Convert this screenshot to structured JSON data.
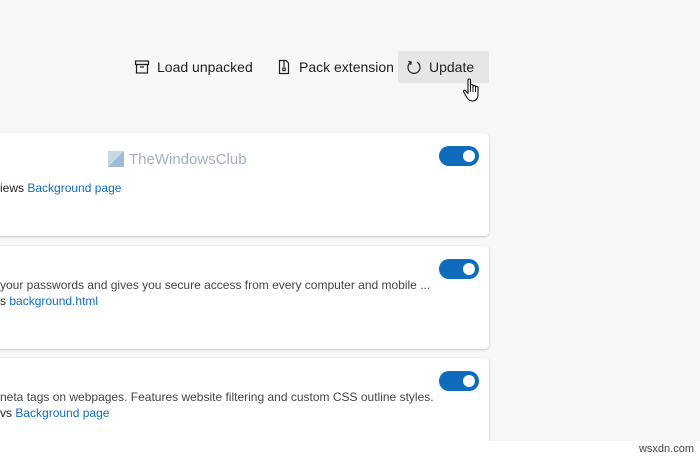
{
  "toolbar": {
    "load_unpacked_label": "Load unpacked",
    "pack_extension_label": "Pack extension",
    "update_label": "Update"
  },
  "extensions": [
    {
      "description": "",
      "views_prefix": "iews",
      "views_link": "Background page",
      "enabled": true
    },
    {
      "description": "your passwords and gives you secure access from every computer and mobile ...",
      "views_prefix": "s",
      "views_link": "background.html",
      "enabled": true
    },
    {
      "description": "neta tags on webpages. Features website filtering and custom CSS outline styles.",
      "views_prefix": "vs",
      "views_link": "Background page",
      "enabled": true
    }
  ],
  "watermark": {
    "text": "TheWindowsClub"
  },
  "site_mark": {
    "text": "wsxdn.com"
  },
  "colors": {
    "accent": "#0f6cbd",
    "page_bg": "#f7f7f7",
    "hover_bg": "#e6e6e6"
  },
  "icons": [
    "load-unpacked-icon",
    "pack-extension-icon",
    "update-icon",
    "hand-cursor-icon"
  ]
}
